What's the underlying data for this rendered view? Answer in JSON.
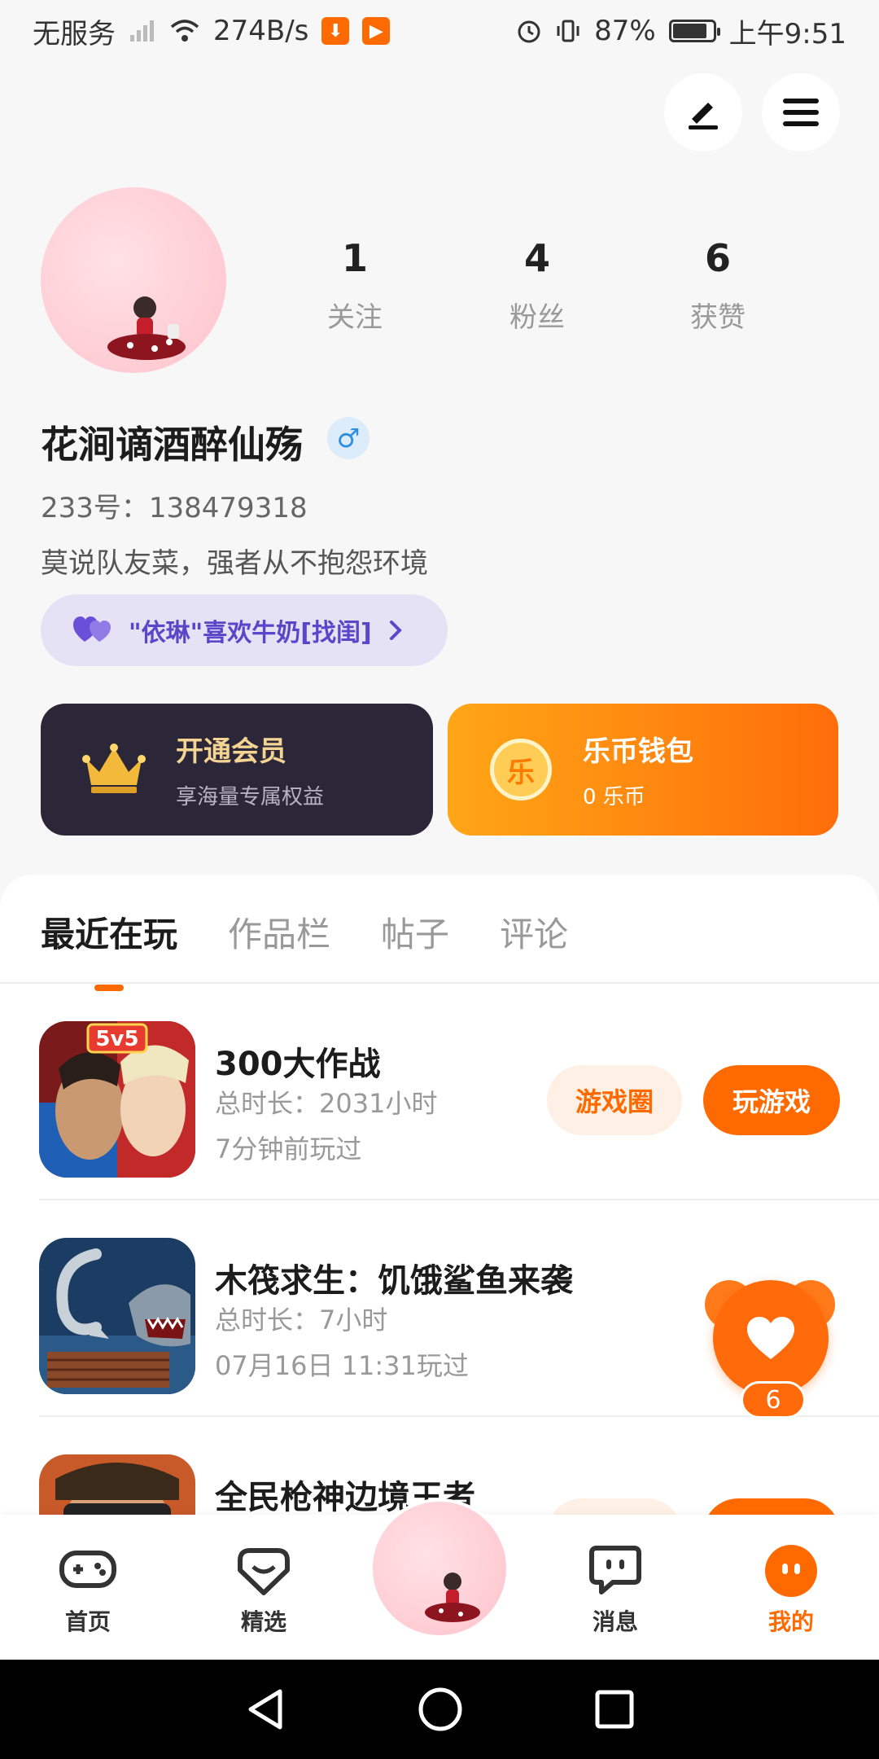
{
  "status_bar": {
    "carrier": "无服务",
    "network_speed": "274B/s",
    "battery_percent": "87%",
    "battery_level": 0.87,
    "time": "上午9:51"
  },
  "header": {
    "edit_icon": "pen-icon",
    "menu_icon": "menu-icon"
  },
  "profile": {
    "stats": [
      {
        "num": "1",
        "label": "关注"
      },
      {
        "num": "4",
        "label": "粉丝"
      },
      {
        "num": "6",
        "label": "获赞"
      }
    ],
    "nickname": "花涧谪酒醉仙殇",
    "gender_symbol": "♂",
    "uid": "233号：138479318",
    "bio": "莫说队友菜，强者从不抱怨环境",
    "tag": "\"依琳\"喜欢牛奶[找闺]"
  },
  "cards": {
    "vip": {
      "title": "开通会员",
      "subtitle": "享海量专属权益"
    },
    "wallet": {
      "title": "乐币钱包",
      "subtitle": "0 乐币",
      "coin_char": "乐"
    }
  },
  "tabs": [
    "最近在玩",
    "作品栏",
    "帖子",
    "评论"
  ],
  "games": [
    {
      "name": "300大作战",
      "duration": "总时长：2031小时",
      "last_played": "7分钟前玩过",
      "circle_btn": "游戏圈",
      "play_btn": "玩游戏",
      "badge": "5v5"
    },
    {
      "name": "木筏求生：饥饿鲨鱼来袭",
      "duration": "总时长：7小时",
      "last_played": "07月16日 11:31玩过"
    },
    {
      "name": "全民枪神边境王者"
    }
  ],
  "like_fab": {
    "count": "6"
  },
  "bottom_nav": [
    {
      "label": "首页",
      "icon": "gamepad-icon"
    },
    {
      "label": "精选",
      "icon": "heart-box-icon"
    },
    {
      "label": "消息",
      "icon": "chat-icon"
    },
    {
      "label": "我的",
      "icon": "face-icon"
    }
  ],
  "colors": {
    "accent": "#ff6a00",
    "vip_bg": "#2b2738",
    "tag_bg": "#e6e2f6"
  }
}
